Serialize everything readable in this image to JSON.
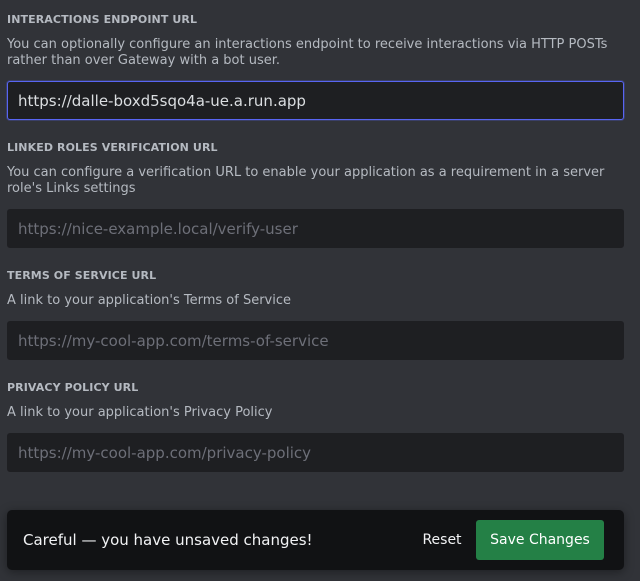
{
  "interactions": {
    "title": "INTERACTIONS ENDPOINT URL",
    "description": "You can optionally configure an interactions endpoint to receive interactions via HTTP POSTs rather than over Gateway with a bot user.",
    "value": "https://dalle-boxd5sqo4a-ue.a.run.app",
    "placeholder": ""
  },
  "linked_roles": {
    "title": "LINKED ROLES VERIFICATION URL",
    "description": "You can configure a verification URL to enable your application as a requirement in a server role's Links settings",
    "value": "",
    "placeholder": "https://nice-example.local/verify-user"
  },
  "terms": {
    "title": "TERMS OF SERVICE URL",
    "description": "A link to your application's Terms of Service",
    "value": "",
    "placeholder": "https://my-cool-app.com/terms-of-service"
  },
  "privacy": {
    "title": "PRIVACY POLICY URL",
    "description": "A link to your application's Privacy Policy",
    "value": "",
    "placeholder": "https://my-cool-app.com/privacy-policy"
  },
  "banner": {
    "message": "Careful — you have unsaved changes!",
    "reset_label": "Reset",
    "save_label": "Save Changes"
  },
  "colors": {
    "background": "#313338",
    "input_bg": "#1e1f22",
    "focus_border": "#5865f2",
    "save_green": "#248046",
    "banner_bg": "#111214"
  }
}
